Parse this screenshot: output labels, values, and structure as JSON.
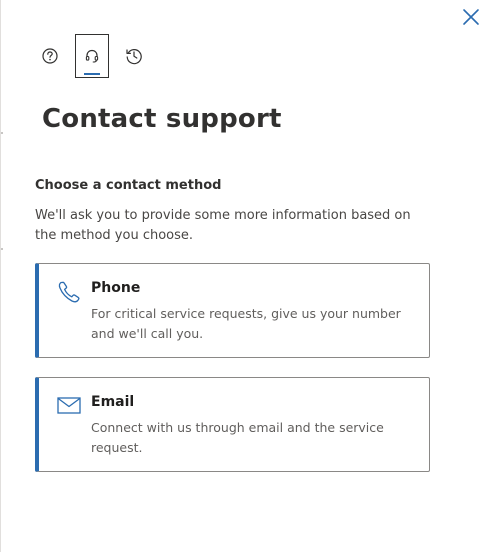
{
  "header": {
    "tabs": [
      {
        "icon": "help-icon",
        "active": false
      },
      {
        "icon": "headset-icon",
        "active": true
      },
      {
        "icon": "history-icon",
        "active": false
      }
    ],
    "close_icon": "close-icon"
  },
  "main": {
    "title": "Contact support",
    "section_heading": "Choose a contact method",
    "description": "We'll ask you to provide some more information based on the method you choose.",
    "methods": [
      {
        "icon": "phone-icon",
        "title": "Phone",
        "description": "For critical service requests, give us your number and we'll call you."
      },
      {
        "icon": "mail-icon",
        "title": "Email",
        "description": "Connect with us through email and the service request."
      }
    ]
  },
  "colors": {
    "accent": "#2b6cb0",
    "text": "#323130",
    "border": "#8a8886"
  }
}
